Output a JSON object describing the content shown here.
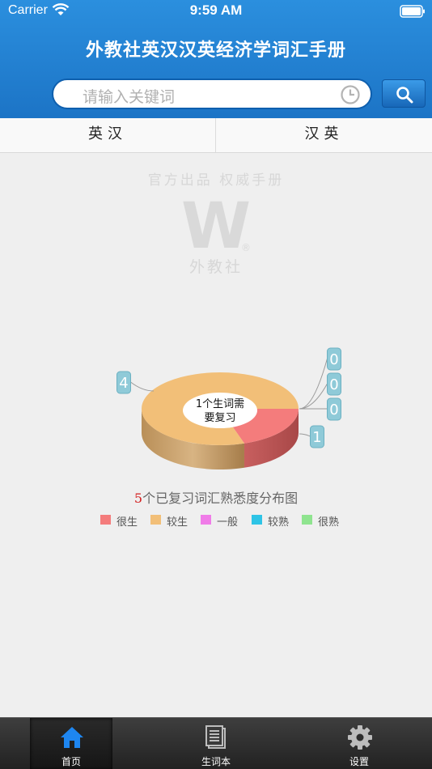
{
  "status_bar": {
    "carrier": "Carrier",
    "time": "9:59 AM"
  },
  "header": {
    "title": "外教社英汉汉英经济学词汇手册"
  },
  "search": {
    "placeholder": "请输入关键词"
  },
  "tabs": [
    {
      "label": "英汉"
    },
    {
      "label": "汉英"
    }
  ],
  "watermark": {
    "slogan": "官方出品 权威手册",
    "publisher": "外教社",
    "logo_letter": "W",
    "registered_mark": "®"
  },
  "chart_data": {
    "type": "pie",
    "center_label_line1": "1个生词需",
    "center_label_line2": "要复习",
    "caption_count": "5",
    "caption_text": "个已复习词汇熟悉度分布图",
    "slices": [
      {
        "name": "很生",
        "value": 1,
        "color": "#f47c7c"
      },
      {
        "name": "较生",
        "value": 4,
        "color": "#f2bf78"
      },
      {
        "name": "一般",
        "value": 0,
        "color": "#f07ce8"
      },
      {
        "name": "较熟",
        "value": 0,
        "color": "#2ec4e6"
      },
      {
        "name": "很熟",
        "value": 0,
        "color": "#8fe48f"
      }
    ]
  },
  "tabbar": {
    "items": [
      {
        "label": "首页",
        "icon": "home-icon",
        "active": true
      },
      {
        "label": "生词本",
        "icon": "notebook-icon",
        "active": false
      },
      {
        "label": "设置",
        "icon": "gear-icon",
        "active": false
      }
    ],
    "active_color": "#1e86f0"
  }
}
